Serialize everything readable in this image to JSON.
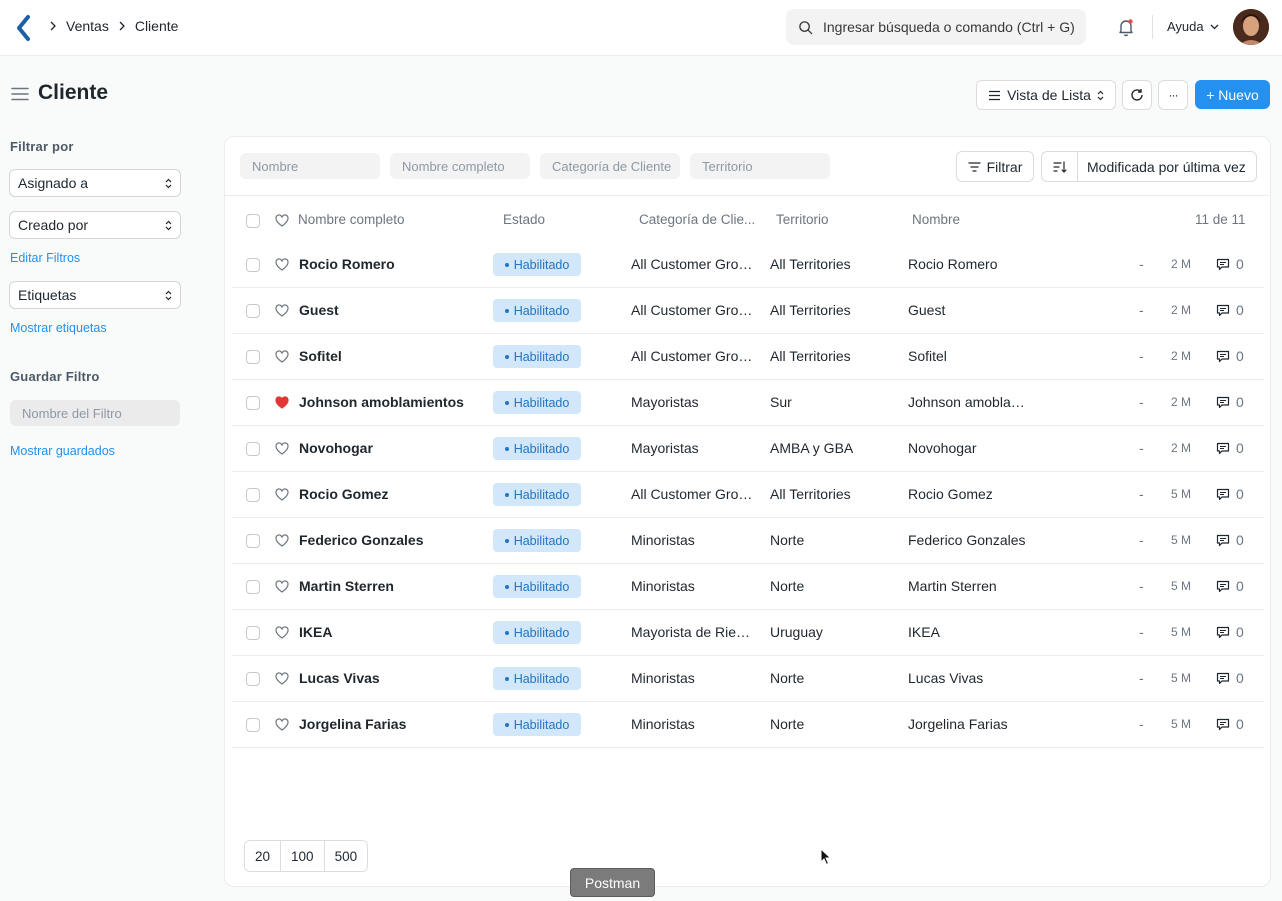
{
  "nav": {
    "breadcrumb": [
      "Ventas",
      "Cliente"
    ],
    "search_placeholder": "Ingresar búsqueda o comando (Ctrl + G)",
    "help_label": "Ayuda"
  },
  "header": {
    "title": "Cliente",
    "view_label": "Vista de Lista",
    "new_label": "+ Nuevo",
    "more_label": "···"
  },
  "sidebar": {
    "filter_by": "Filtrar por",
    "assigned_to": "Asignado a",
    "created_by": "Creado por",
    "edit_filters": "Editar Filtros",
    "tags": "Etiquetas",
    "show_tags": "Mostrar etiquetas",
    "save_filter": "Guardar Filtro",
    "filter_name_placeholder": "Nombre del Filtro",
    "show_saved": "Mostrar guardados"
  },
  "filters": {
    "nombre": "Nombre",
    "nombre_completo": "Nombre completo",
    "categoria": "Categoría de Cliente",
    "territorio": "Territorio",
    "filter_button": "Filtrar",
    "sort_label": "Modificada por última vez"
  },
  "table": {
    "headers": {
      "full_name": "Nombre completo",
      "status": "Estado",
      "category": "Categoría de Clie...",
      "territory": "Territorio",
      "name": "Nombre",
      "count": "11 de 11"
    },
    "rows": [
      {
        "full_name": "Rocio Romero",
        "status": "Habilitado",
        "category": "All Customer Groups",
        "territory": "All Territories",
        "name": "Rocio Romero",
        "dash": "-",
        "modified": "2 M",
        "comments": "0",
        "liked": false
      },
      {
        "full_name": "Guest",
        "status": "Habilitado",
        "category": "All Customer Groups",
        "territory": "All Territories",
        "name": "Guest",
        "dash": "-",
        "modified": "2 M",
        "comments": "0",
        "liked": false
      },
      {
        "full_name": "Sofitel",
        "status": "Habilitado",
        "category": "All Customer Groups",
        "territory": "All Territories",
        "name": "Sofitel",
        "dash": "-",
        "modified": "2 M",
        "comments": "0",
        "liked": false
      },
      {
        "full_name": "Johnson amoblamientos",
        "status": "Habilitado",
        "category": "Mayoristas",
        "territory": "Sur",
        "name": "Johnson amoblamientos",
        "dash": "-",
        "modified": "2 M",
        "comments": "0",
        "liked": true
      },
      {
        "full_name": "Novohogar",
        "status": "Habilitado",
        "category": "Mayoristas",
        "territory": "AMBA y GBA",
        "name": "Novohogar",
        "dash": "-",
        "modified": "2 M",
        "comments": "0",
        "liked": false
      },
      {
        "full_name": "Rocio Gomez",
        "status": "Habilitado",
        "category": "All Customer Groups",
        "territory": "All Territories",
        "name": "Rocio Gomez",
        "dash": "-",
        "modified": "5 M",
        "comments": "0",
        "liked": false
      },
      {
        "full_name": "Federico Gonzales",
        "status": "Habilitado",
        "category": "Minoristas",
        "territory": "Norte",
        "name": "Federico Gonzales",
        "dash": "-",
        "modified": "5 M",
        "comments": "0",
        "liked": false
      },
      {
        "full_name": "Martin Sterren",
        "status": "Habilitado",
        "category": "Minoristas",
        "territory": "Norte",
        "name": "Martin Sterren",
        "dash": "-",
        "modified": "5 M",
        "comments": "0",
        "liked": false
      },
      {
        "full_name": "IKEA",
        "status": "Habilitado",
        "category": "Mayorista de Riesgo",
        "territory": "Uruguay",
        "name": "IKEA",
        "dash": "-",
        "modified": "5 M",
        "comments": "0",
        "liked": false
      },
      {
        "full_name": "Lucas Vivas",
        "status": "Habilitado",
        "category": "Minoristas",
        "territory": "Norte",
        "name": "Lucas Vivas",
        "dash": "-",
        "modified": "5 M",
        "comments": "0",
        "liked": false
      },
      {
        "full_name": "Jorgelina Farias",
        "status": "Habilitado",
        "category": "Minoristas",
        "territory": "Norte",
        "name": "Jorgelina Farias",
        "dash": "-",
        "modified": "5 M",
        "comments": "0",
        "liked": false
      }
    ]
  },
  "pager": [
    "20",
    "100",
    "500"
  ],
  "tooltip": "Postman",
  "colors": {
    "primary": "#2490ef",
    "pill_bg": "#d2e8fa",
    "liked_heart": "#e03636"
  }
}
